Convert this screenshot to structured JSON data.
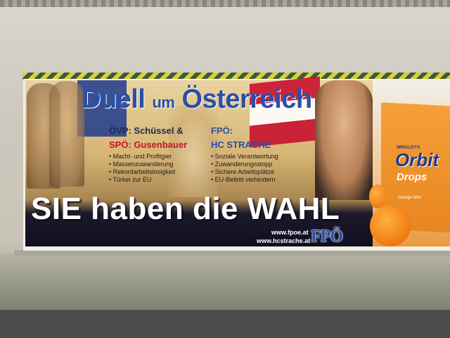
{
  "poster": {
    "headline_part1": "Duell ",
    "headline_um": "um",
    "headline_part2": " Österreich",
    "oevp_line": "ÖVP: Schüssel &",
    "spoe_line": "SPÖ: Gusenbauer",
    "fpoe_label": "FPÖ:",
    "fpoe_name": "HC STRACHE",
    "left_bullets": [
      "Macht- und Profitgier",
      "Massenzuwanderung",
      "Rekordarbeitslosigkeit",
      "Türkei zur EU"
    ],
    "right_bullets": [
      "Soziale Verantwortung",
      "Zuwanderungsstopp",
      "Sichere Arbeitsplätze",
      "EU-Beitritt verhindern"
    ],
    "slogan": "SIE haben die WAHL",
    "url1": "www.fpoe.at",
    "url2": "www.hcstrache.at",
    "logo": "FPÖ"
  },
  "adjacent_ad": {
    "brand_small": "WRIGLEY'S",
    "brand": "Orbit",
    "product": "Drops",
    "flavor": "Orange Mint"
  }
}
